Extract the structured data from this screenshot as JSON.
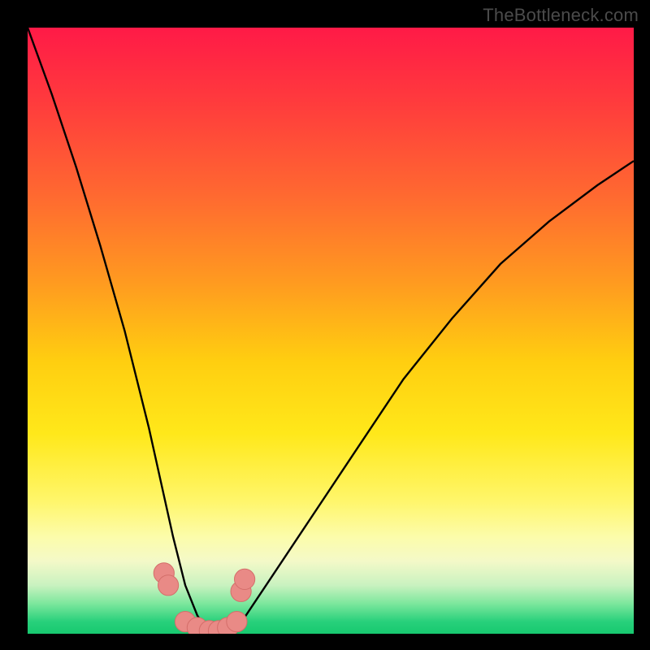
{
  "watermark": {
    "text": "TheBottleneck.com"
  },
  "chart_data": {
    "type": "line",
    "title": "",
    "xlabel": "",
    "ylabel": "",
    "xlim": [
      0,
      100
    ],
    "ylim": [
      0,
      100
    ],
    "grid": false,
    "series": [
      {
        "name": "curve",
        "x": [
          0,
          4,
          8,
          12,
          16,
          20,
          22,
          24,
          26,
          28,
          30,
          32,
          34,
          36,
          40,
          46,
          54,
          62,
          70,
          78,
          86,
          94,
          100
        ],
        "values": [
          100,
          89,
          77,
          64,
          50,
          34,
          25,
          16,
          8,
          3,
          0,
          0,
          0,
          3,
          9,
          18,
          30,
          42,
          52,
          61,
          68,
          74,
          78
        ]
      }
    ],
    "markers": [
      {
        "x": 22.5,
        "y": 10,
        "r": 1.6
      },
      {
        "x": 23.2,
        "y": 8,
        "r": 1.6
      },
      {
        "x": 26.0,
        "y": 2,
        "r": 1.6
      },
      {
        "x": 28.0,
        "y": 1,
        "r": 1.6
      },
      {
        "x": 30.0,
        "y": 0.5,
        "r": 1.6
      },
      {
        "x": 31.5,
        "y": 0.5,
        "r": 1.6
      },
      {
        "x": 33.0,
        "y": 1,
        "r": 1.6
      },
      {
        "x": 34.5,
        "y": 2,
        "r": 1.6
      },
      {
        "x": 35.2,
        "y": 7,
        "r": 1.6
      },
      {
        "x": 35.8,
        "y": 9,
        "r": 1.6
      }
    ],
    "colors": {
      "curve": "#000000",
      "marker_fill": "#e98a86",
      "marker_stroke": "#d46e6a"
    }
  }
}
